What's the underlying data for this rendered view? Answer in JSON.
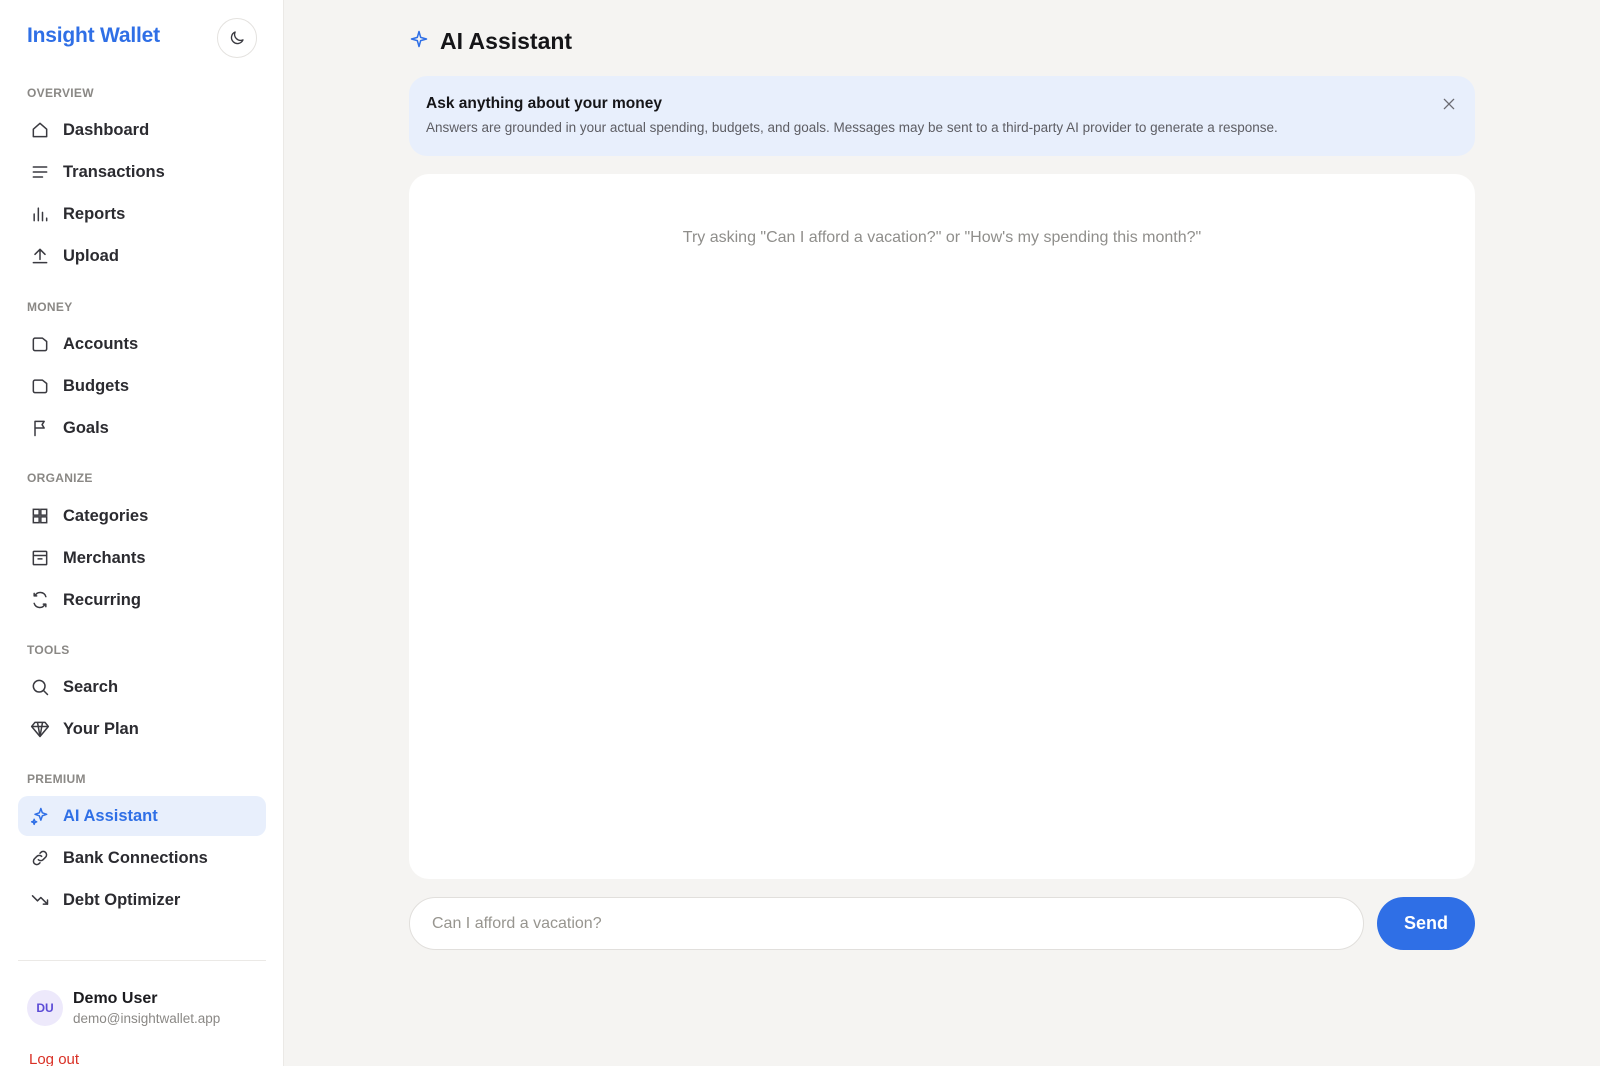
{
  "app": {
    "brand": "Insight Wallet"
  },
  "sidebar": {
    "sections": {
      "overview": "OVERVIEW",
      "money": "MONEY",
      "organize": "ORGANIZE",
      "tools": "TOOLS",
      "premium": "PREMIUM"
    },
    "items": {
      "dashboard": {
        "label": "Dashboard",
        "icon": "home-icon"
      },
      "transactions": {
        "label": "Transactions",
        "icon": "list-icon"
      },
      "reports": {
        "label": "Reports",
        "icon": "bar-chart-icon"
      },
      "upload": {
        "label": "Upload",
        "icon": "upload-icon"
      },
      "accounts": {
        "label": "Accounts",
        "icon": "wallet-icon"
      },
      "budgets": {
        "label": "Budgets",
        "icon": "wallet-icon"
      },
      "goals": {
        "label": "Goals",
        "icon": "flag-icon"
      },
      "categories": {
        "label": "Categories",
        "icon": "grid-icon"
      },
      "merchants": {
        "label": "Merchants",
        "icon": "store-icon"
      },
      "recurring": {
        "label": "Recurring",
        "icon": "refresh-icon"
      },
      "search": {
        "label": "Search",
        "icon": "search-icon"
      },
      "your_plan": {
        "label": "Your Plan",
        "icon": "diamond-icon"
      },
      "ai_assistant": {
        "label": "AI Assistant",
        "icon": "sparkle-icon",
        "active": true
      },
      "bank_connections": {
        "label": "Bank Connections",
        "icon": "link-icon"
      },
      "debt_optimizer": {
        "label": "Debt Optimizer",
        "icon": "trend-down-icon"
      }
    },
    "user": {
      "initials": "DU",
      "name": "Demo User",
      "email": "demo@insightwallet.app",
      "logout_label": "Log out"
    }
  },
  "main": {
    "title": "AI Assistant",
    "banner": {
      "title": "Ask anything about your money",
      "description": "Answers are grounded in your actual spending, budgets, and goals. Messages may be sent to a third-party AI provider to generate a response."
    },
    "chat": {
      "hint": "Try asking \"Can I afford a vacation?\" or \"How's my spending this month?\"",
      "input_value": "",
      "input_placeholder": "Can I afford a vacation?",
      "send_label": "Send"
    }
  },
  "colors": {
    "accent": "#2f6fe6",
    "active_bg": "#e8effc",
    "logout": "#d93025"
  }
}
